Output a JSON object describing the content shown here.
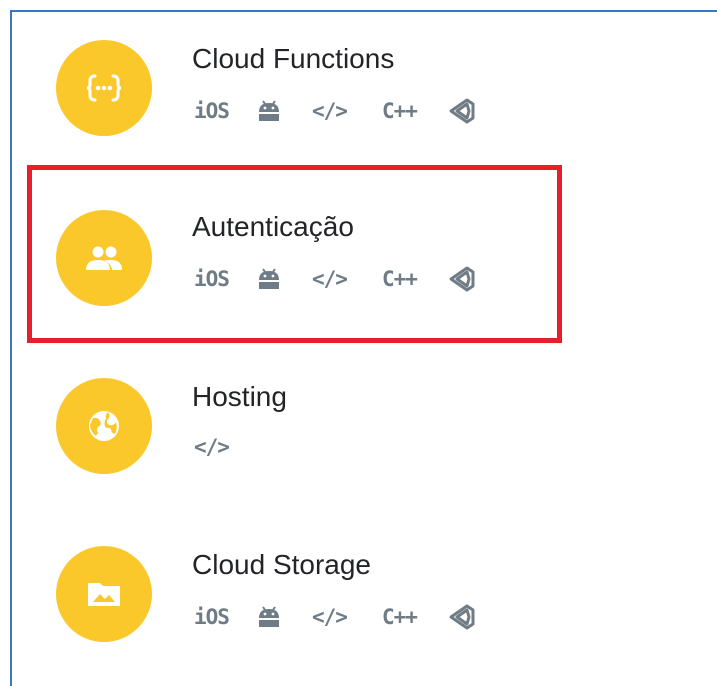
{
  "products": [
    {
      "id": "cloud-functions",
      "title": "Cloud Functions",
      "icon": "functions-icon",
      "platforms": [
        "iOS",
        "Android",
        "Web",
        "C++",
        "Unity"
      ]
    },
    {
      "id": "authentication",
      "title": "Autenticação",
      "icon": "people-icon",
      "platforms": [
        "iOS",
        "Android",
        "Web",
        "C++",
        "Unity"
      ],
      "highlighted": true
    },
    {
      "id": "hosting",
      "title": "Hosting",
      "icon": "globe-icon",
      "platforms": [
        "Web"
      ]
    },
    {
      "id": "cloud-storage",
      "title": "Cloud Storage",
      "icon": "folder-image-icon",
      "platforms": [
        "iOS",
        "Android",
        "Web",
        "C++",
        "Unity"
      ]
    }
  ],
  "platform_labels": {
    "ios": "iOS",
    "web": "</>",
    "cpp": "C++"
  },
  "colors": {
    "icon_circle": "#fbc82b",
    "platform_icon": "#6f7c86",
    "title_text": "#222428",
    "highlight_border": "#e5202a",
    "frame_border": "#3b78c4"
  }
}
